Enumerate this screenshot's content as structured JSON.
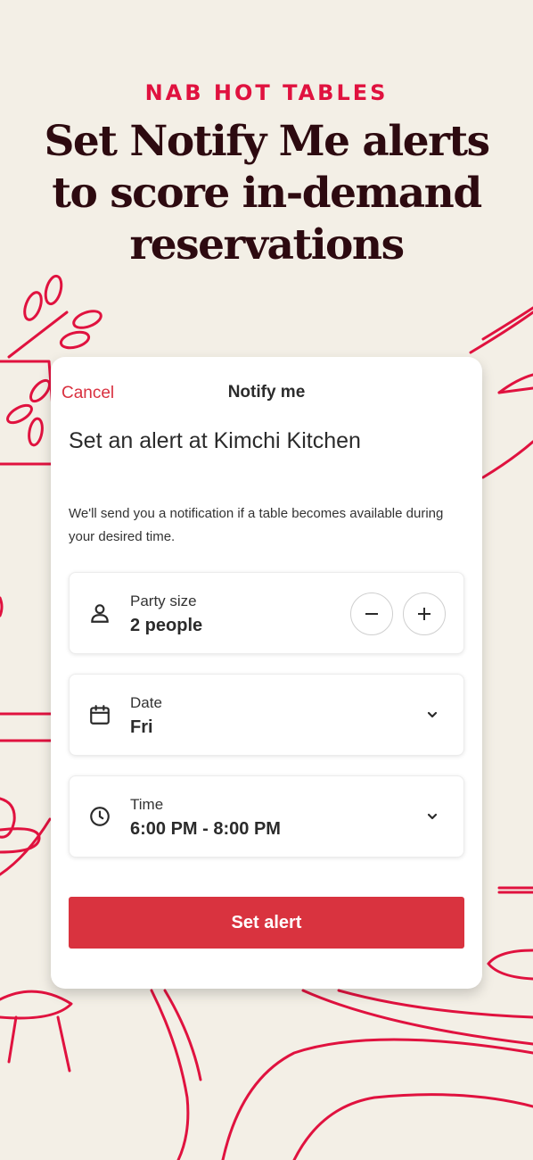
{
  "promo": {
    "eyebrow": "NAB HOT TABLES",
    "headline": "Set Notify Me alerts\nto score in-demand\nreservations"
  },
  "modal": {
    "cancel_label": "Cancel",
    "title": "Notify me",
    "heading": "Set an alert at Kimchi Kitchen",
    "description": "We'll send you a notification if a table becomes available during your desired time.",
    "party": {
      "label": "Party size",
      "value": "2 people",
      "icon": "person-icon"
    },
    "date": {
      "label": "Date",
      "value": "Fri",
      "icon": "calendar-icon"
    },
    "time": {
      "label": "Time",
      "value": "6:00 PM - 8:00 PM",
      "icon": "clock-icon"
    },
    "submit_label": "Set alert"
  },
  "colors": {
    "accent": "#d9333f",
    "brand_red": "#e0123f",
    "background": "#f3efe6",
    "headline": "#2d0a10"
  }
}
